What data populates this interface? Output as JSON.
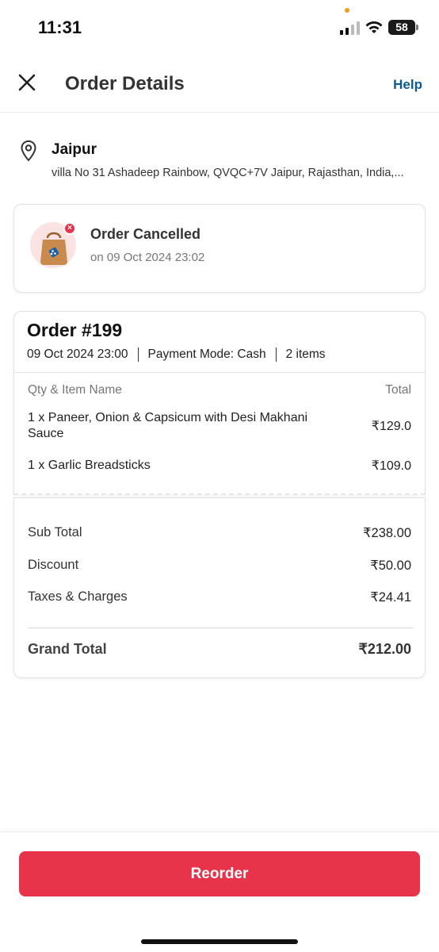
{
  "status_bar": {
    "time": "11:31",
    "battery": "58"
  },
  "header": {
    "title": "Order Details",
    "help_label": "Help"
  },
  "address": {
    "city": "Jaipur",
    "street": "villa No 31 Ashadeep Rainbow, QVQC+7V Jaipur, Rajasthan, India,..."
  },
  "order_status": {
    "title": "Order Cancelled",
    "date": "on 09 Oct 2024 23:02"
  },
  "order": {
    "title": "Order #199",
    "datetime": "09 Oct 2024 23:00",
    "payment_mode": "Payment Mode: Cash",
    "item_count": "2 items",
    "columns": {
      "left": "Qty & Item Name",
      "right": "Total"
    },
    "items": [
      {
        "name": "1 x Paneer, Onion & Capsicum with Desi Makhani Sauce",
        "price": "₹129.0"
      },
      {
        "name": "1 x Garlic Breadsticks",
        "price": "₹109.0"
      }
    ]
  },
  "totals": {
    "rows": [
      {
        "label": "Sub Total",
        "value": "₹238.00"
      },
      {
        "label": "Discount",
        "value": "₹50.00"
      },
      {
        "label": "Taxes & Charges",
        "value": "₹24.41"
      }
    ],
    "grand_label": "Grand Total",
    "grand_value": "₹212.00"
  },
  "actions": {
    "reorder_label": "Reorder"
  },
  "colors": {
    "accent": "#e8344a",
    "link": "#0a5a96",
    "bag": "#c98a4e"
  }
}
